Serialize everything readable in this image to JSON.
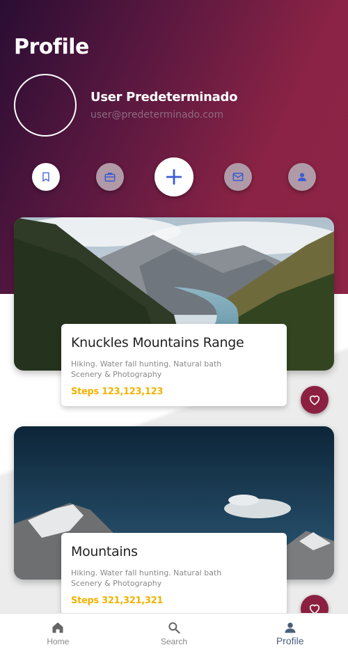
{
  "header": {
    "title": "Profile",
    "user_name": "User Predeterminado",
    "user_email": "user@predeterminado.com"
  },
  "actions": [
    {
      "icon": "bookmark-icon"
    },
    {
      "icon": "briefcase-icon"
    },
    {
      "icon": "plus-icon"
    },
    {
      "icon": "mail-icon"
    },
    {
      "icon": "person-icon"
    }
  ],
  "cards": [
    {
      "title": "Knuckles Mountains Range",
      "description": "Hiking. Water fall hunting. Natural bath Scenery & Photography",
      "steps": "Steps 123,123,123"
    },
    {
      "title": "Mountains",
      "description": "Hiking. Water fall hunting. Natural bath Scenery & Photography",
      "steps": "Steps 321,321,321"
    }
  ],
  "bottom_nav": [
    {
      "label": "Home",
      "icon": "home-icon"
    },
    {
      "label": "Search",
      "icon": "search-icon"
    },
    {
      "label": "Profile",
      "icon": "person-icon",
      "active": true
    }
  ],
  "colors": {
    "accent": "#8c2041",
    "steps": "#f2b200",
    "primary_icon": "#3b5bd6"
  }
}
